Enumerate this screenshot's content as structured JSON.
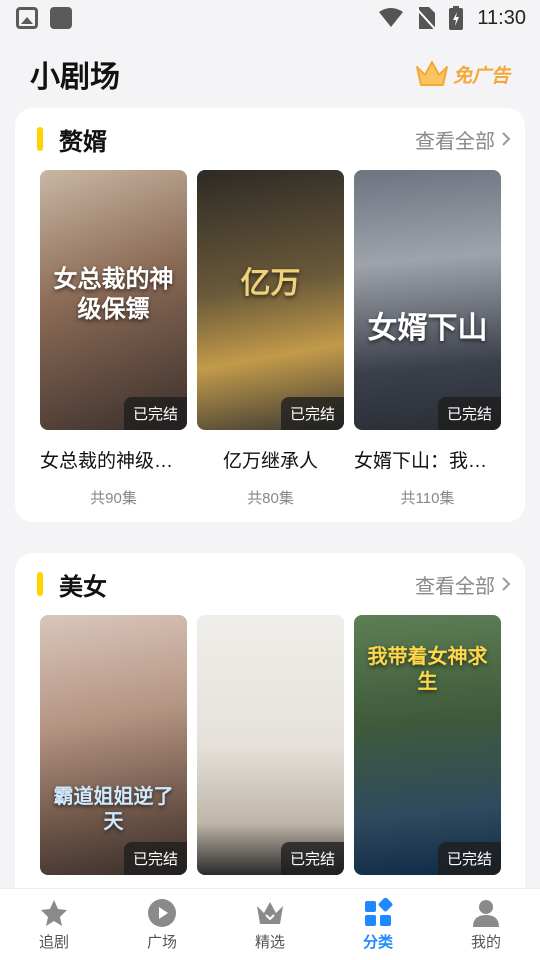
{
  "status": {
    "time": "11:30"
  },
  "header": {
    "title": "小剧场",
    "no_ads": "免广告"
  },
  "sections": [
    {
      "title": "赘婿",
      "view_all": "查看全部",
      "cards": [
        {
          "title": "女总裁的神级保镖",
          "episodes": "共90集",
          "badge": "已完结",
          "poster_text": "女总裁的神级保镖"
        },
        {
          "title": "亿万继承人",
          "episodes": "共80集",
          "badge": "已完结",
          "poster_text": "亿万"
        },
        {
          "title": "女婿下山：我天下无敌",
          "episodes": "共110集",
          "badge": "已完结",
          "poster_text": "女婿下山"
        }
      ]
    },
    {
      "title": "美女",
      "view_all": "查看全部",
      "cards": [
        {
          "badge": "已完结",
          "poster_text": "霸道姐姐逆了天"
        },
        {
          "badge": "已完结",
          "poster_text": ""
        },
        {
          "badge": "已完结",
          "poster_text": "我带着女神求生"
        }
      ]
    }
  ],
  "nav": [
    {
      "label": "追剧",
      "icon": "star-icon"
    },
    {
      "label": "广场",
      "icon": "play-icon"
    },
    {
      "label": "精选",
      "icon": "crown-icon"
    },
    {
      "label": "分类",
      "icon": "category-icon",
      "active": true
    },
    {
      "label": "我的",
      "icon": "profile-icon"
    }
  ],
  "colors": {
    "accent": "#1e88ff",
    "section_bar": "#ffd200",
    "no_ads": "#f5a73b"
  }
}
